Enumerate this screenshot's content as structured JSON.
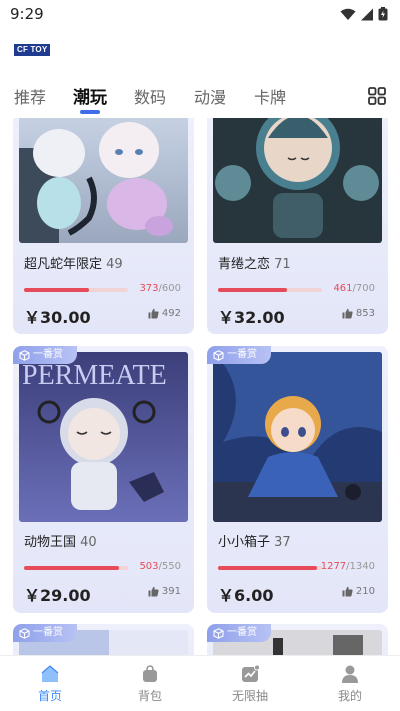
{
  "status": {
    "time": "9:29"
  },
  "brand": {
    "logo_text": "CF TOY"
  },
  "tabs": [
    {
      "label": "推荐"
    },
    {
      "label": "潮玩"
    },
    {
      "label": "数码"
    },
    {
      "label": "动漫"
    },
    {
      "label": "卡牌"
    }
  ],
  "active_tab": "潮玩",
  "cards": [
    {
      "name": "超凡蛇年限定",
      "count": "49",
      "sold": "373",
      "total": "600",
      "progress": 0.622,
      "price": "￥30.00",
      "likes": "492"
    },
    {
      "name": "青绻之恋",
      "count": "71",
      "sold": "461",
      "total": "700",
      "progress": 0.659,
      "price": "￥32.00",
      "likes": "853"
    },
    {
      "name": "动物王国",
      "count": "40",
      "sold": "503",
      "total": "550",
      "progress": 0.915,
      "price": "￥29.00",
      "likes": "391",
      "badge": "一番赏",
      "image_text": "PERMEATE"
    },
    {
      "name": "小小箱子",
      "count": "37",
      "sold": "1277",
      "total": "1340",
      "progress": 0.953,
      "price": "￥6.00",
      "likes": "210",
      "badge": "一番赏"
    },
    {
      "badge": "一番赏"
    },
    {
      "badge": "一番赏"
    }
  ],
  "bottom_nav": [
    {
      "label": "首页",
      "icon": "home-icon",
      "active": true
    },
    {
      "label": "背包",
      "icon": "bag-icon"
    },
    {
      "label": "无限抽",
      "icon": "chart-icon"
    },
    {
      "label": "我的",
      "icon": "user-icon"
    }
  ],
  "colors": {
    "accent": "#3d6ee8",
    "progress": "#e64b5a",
    "nav_active": "#3d8af7",
    "badge": "#8fa0ea"
  }
}
